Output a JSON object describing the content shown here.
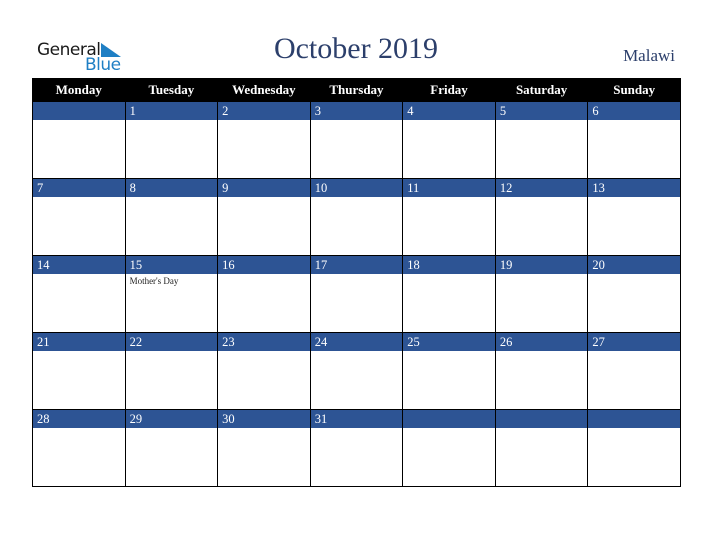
{
  "logo": {
    "general": "General",
    "blue": "Blue"
  },
  "header": {
    "title": "October 2019",
    "country": "Malawi"
  },
  "colors": {
    "band": "#2d5494",
    "title": "#2c3f6b",
    "logo_blue": "#1f7fc4"
  },
  "weekdays": [
    "Monday",
    "Tuesday",
    "Wednesday",
    "Thursday",
    "Friday",
    "Saturday",
    "Sunday"
  ],
  "weeks": [
    [
      {
        "day": ""
      },
      {
        "day": "1"
      },
      {
        "day": "2"
      },
      {
        "day": "3"
      },
      {
        "day": "4"
      },
      {
        "day": "5"
      },
      {
        "day": "6"
      }
    ],
    [
      {
        "day": "7"
      },
      {
        "day": "8"
      },
      {
        "day": "9"
      },
      {
        "day": "10"
      },
      {
        "day": "11"
      },
      {
        "day": "12"
      },
      {
        "day": "13"
      }
    ],
    [
      {
        "day": "14"
      },
      {
        "day": "15",
        "event": "Mother's Day"
      },
      {
        "day": "16"
      },
      {
        "day": "17"
      },
      {
        "day": "18"
      },
      {
        "day": "19"
      },
      {
        "day": "20"
      }
    ],
    [
      {
        "day": "21"
      },
      {
        "day": "22"
      },
      {
        "day": "23"
      },
      {
        "day": "24"
      },
      {
        "day": "25"
      },
      {
        "day": "26"
      },
      {
        "day": "27"
      }
    ],
    [
      {
        "day": "28"
      },
      {
        "day": "29"
      },
      {
        "day": "30"
      },
      {
        "day": "31"
      },
      {
        "day": ""
      },
      {
        "day": ""
      },
      {
        "day": ""
      }
    ]
  ]
}
